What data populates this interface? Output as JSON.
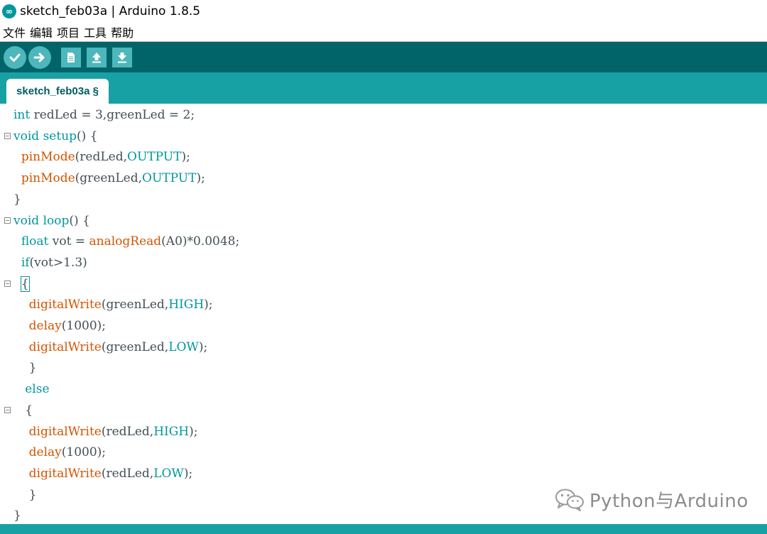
{
  "window": {
    "title": "sketch_feb03a | Arduino 1.8.5"
  },
  "menu": {
    "items": [
      "文件",
      "编辑",
      "项目",
      "工具",
      "帮助"
    ]
  },
  "toolbar": {
    "buttons": [
      "verify-icon",
      "upload-icon",
      "new-icon",
      "open-icon",
      "save-icon"
    ]
  },
  "tabs": [
    {
      "label": "sketch_feb03a §"
    }
  ],
  "colors": {
    "toolbar_bg": "#006468",
    "tabstrip_bg": "#17a1a5",
    "keyword": "#00979c",
    "function": "#d35400",
    "text": "#434f54"
  },
  "code": {
    "lines": [
      [
        {
          "t": "int",
          "c": "kw"
        },
        {
          "t": " redLed = 3,greenLed = 2;"
        }
      ],
      [
        {
          "t": "void",
          "c": "kw"
        },
        {
          "t": " "
        },
        {
          "t": "setup",
          "c": "kw"
        },
        {
          "t": "() {"
        }
      ],
      [
        {
          "t": "  "
        },
        {
          "t": "pinMode",
          "c": "fn"
        },
        {
          "t": "(redLed,"
        },
        {
          "t": "OUTPUT",
          "c": "cn"
        },
        {
          "t": ");"
        }
      ],
      [
        {
          "t": "  "
        },
        {
          "t": "pinMode",
          "c": "fn"
        },
        {
          "t": "(greenLed,"
        },
        {
          "t": "OUTPUT",
          "c": "cn"
        },
        {
          "t": ");"
        }
      ],
      [
        {
          "t": "}"
        }
      ],
      [
        {
          "t": "void",
          "c": "kw"
        },
        {
          "t": " "
        },
        {
          "t": "loop",
          "c": "kw"
        },
        {
          "t": "() {"
        }
      ],
      [
        {
          "t": "  "
        },
        {
          "t": "float",
          "c": "kw"
        },
        {
          "t": " vot = "
        },
        {
          "t": "analogRead",
          "c": "fn"
        },
        {
          "t": "(A0)*0.0048;"
        }
      ],
      [
        {
          "t": "  "
        },
        {
          "t": "if",
          "c": "kw"
        },
        {
          "t": "(vot>1.3)"
        }
      ],
      [
        {
          "t": "  "
        },
        {
          "t": "{",
          "c": "box"
        }
      ],
      [
        {
          "t": "    "
        },
        {
          "t": "digitalWrite",
          "c": "fn"
        },
        {
          "t": "(greenLed,"
        },
        {
          "t": "HIGH",
          "c": "cn"
        },
        {
          "t": ");"
        }
      ],
      [
        {
          "t": "    "
        },
        {
          "t": "delay",
          "c": "fn"
        },
        {
          "t": "(1000);"
        }
      ],
      [
        {
          "t": "    "
        },
        {
          "t": "digitalWrite",
          "c": "fn"
        },
        {
          "t": "(greenLed,"
        },
        {
          "t": "LOW",
          "c": "cn"
        },
        {
          "t": ");"
        }
      ],
      [
        {
          "t": "    }"
        }
      ],
      [
        {
          "t": "   "
        },
        {
          "t": "else",
          "c": "kw"
        }
      ],
      [
        {
          "t": "   {"
        }
      ],
      [
        {
          "t": "    "
        },
        {
          "t": "digitalWrite",
          "c": "fn"
        },
        {
          "t": "(redLed,"
        },
        {
          "t": "HIGH",
          "c": "cn"
        },
        {
          "t": ");"
        }
      ],
      [
        {
          "t": "    "
        },
        {
          "t": "delay",
          "c": "fn"
        },
        {
          "t": "(1000);"
        }
      ],
      [
        {
          "t": "    "
        },
        {
          "t": "digitalWrite",
          "c": "fn"
        },
        {
          "t": "(redLed,"
        },
        {
          "t": "LOW",
          "c": "cn"
        },
        {
          "t": ");"
        }
      ],
      [
        {
          "t": "    }"
        }
      ],
      [
        {
          "t": "}"
        }
      ]
    ],
    "fold_lines": [
      1,
      5,
      8,
      14
    ]
  },
  "watermark": {
    "text": "Python与Arduino"
  }
}
